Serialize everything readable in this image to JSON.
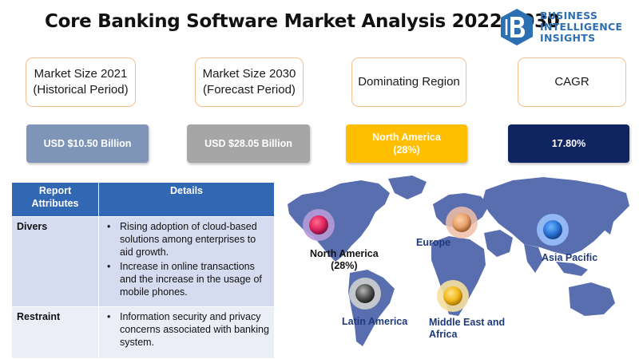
{
  "title": "Core Banking Software Market Analysis 2022-2030",
  "logo": {
    "lines": [
      "BUSINESS",
      "INTELLIGENCE",
      "INSIGHTS"
    ]
  },
  "metrics": [
    {
      "label_line1": "Market Size 2021",
      "label_line2": "(Historical Period)",
      "value_line1": "USD $10.50 Billion",
      "value_line2": "",
      "color": "#7e95b8"
    },
    {
      "label_line1": "Market Size 2030",
      "label_line2": "(Forecast Period)",
      "value_line1": "USD $28.05 Billion",
      "value_line2": "",
      "color": "#a6a6a6"
    },
    {
      "label_line1": "Dominating Region",
      "label_line2": "",
      "value_line1": "North America",
      "value_line2": "(28%)",
      "color": "#ffbf00"
    },
    {
      "label_line1": "CAGR",
      "label_line2": "",
      "value_line1": "17.80%",
      "value_line2": "",
      "color": "#0f2460"
    }
  ],
  "table": {
    "headers": [
      "Report Attributes",
      "Details"
    ],
    "rows": [
      {
        "attribute": "Divers",
        "points": [
          "Rising adoption of cloud-based solutions among enterprises to aid growth.",
          "Increase in online transactions and the increase in the usage of mobile phones."
        ]
      },
      {
        "attribute": "Restraint",
        "points": [
          " Information security and privacy concerns associated with banking system."
        ]
      }
    ]
  },
  "regions": [
    {
      "name": "North America",
      "sub": "(28%)",
      "marker_color": "#e0245e"
    },
    {
      "name": "Europe",
      "sub": "",
      "marker_color": "#e9a06b"
    },
    {
      "name": "Asia Pacific",
      "sub": "",
      "marker_color": "#2b74d8"
    },
    {
      "name": "Latin America",
      "sub": "",
      "marker_color": "#555555"
    },
    {
      "name": "Middle  East and",
      "sub": "Africa",
      "marker_color": "#f3b81c"
    }
  ]
}
